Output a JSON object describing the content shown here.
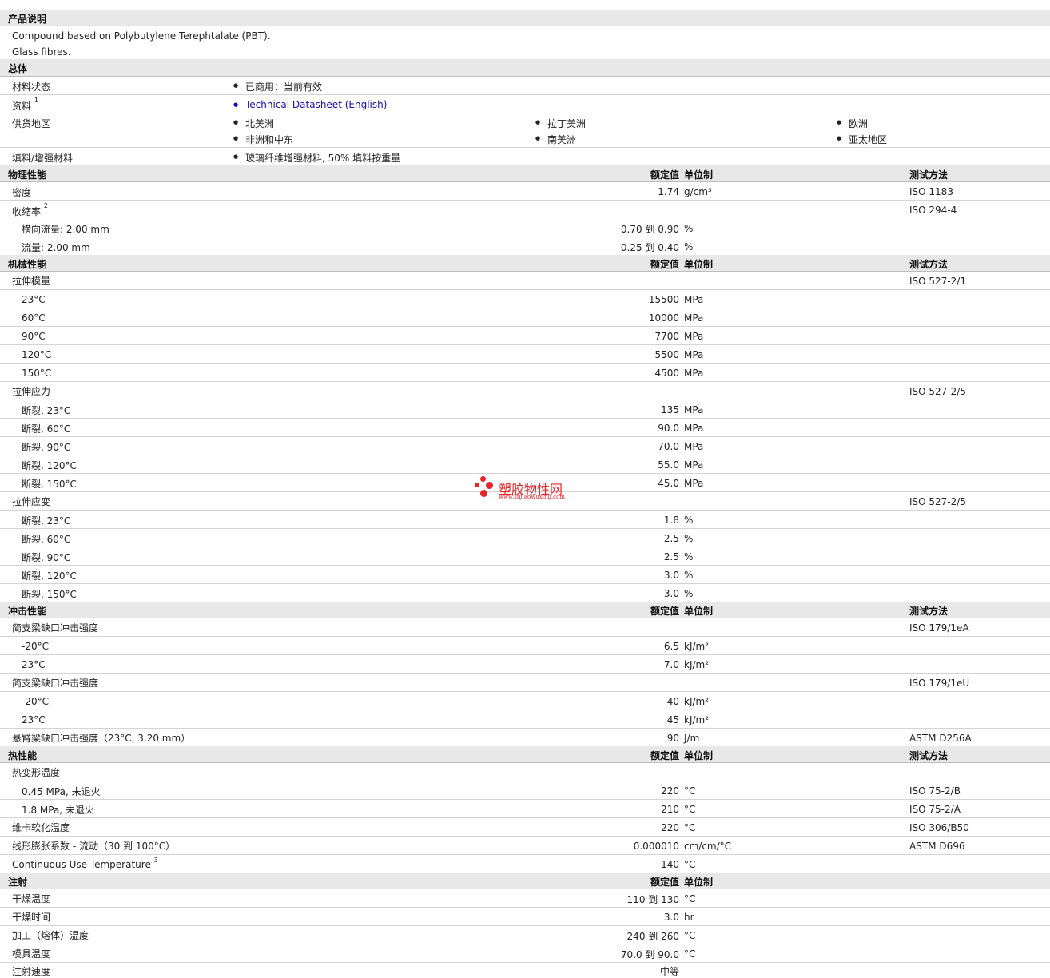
{
  "desc": {
    "header": "产品说明",
    "line1": "Compound based on Polybutylene Terephtalate (PBT).",
    "line2": "Glass fibres."
  },
  "general": {
    "header": "总体",
    "status_label": "材料状态",
    "status_value": "已商用：当前有效",
    "doc_label": "资料",
    "doc_sup": "1",
    "doc_link": "Technical Datasheet (English)",
    "region_label": "供货地区",
    "regions": [
      "北美洲",
      "拉丁美洲",
      "欧洲",
      "非洲和中东",
      "南美洲",
      "亚太地区"
    ],
    "filler_label": "填料/增强材料",
    "filler_value": "玻璃纤维增强材料, 50% 填料按重量"
  },
  "col_headers": {
    "value": "额定值",
    "unit": "单位制",
    "method": "测试方法"
  },
  "physical": {
    "header": "物理性能",
    "density_label": "密度",
    "density_value": "1.74",
    "density_unit": "g/cm³",
    "density_method": "ISO 1183",
    "shrink_label": "收缩率",
    "shrink_sup": "2",
    "shrink_method": "ISO 294-4",
    "shrink_rows": [
      {
        "label": "横向流量: 2.00 mm",
        "value": "0.70 到  0.90",
        "unit": "%"
      },
      {
        "label": "流量: 2.00 mm",
        "value": "0.25 到  0.40",
        "unit": "%"
      }
    ]
  },
  "mechanical": {
    "header": "机械性能",
    "modulus_label": "拉伸模量",
    "modulus_method": "ISO 527-2/1",
    "modulus_rows": [
      {
        "label": "23°C",
        "value": "15500",
        "unit": "MPa"
      },
      {
        "label": "60°C",
        "value": "10000",
        "unit": "MPa"
      },
      {
        "label": "90°C",
        "value": "7700",
        "unit": "MPa"
      },
      {
        "label": "120°C",
        "value": "5500",
        "unit": "MPa"
      },
      {
        "label": "150°C",
        "value": "4500",
        "unit": "MPa"
      }
    ],
    "stress_label": "拉伸应力",
    "stress_method": "ISO 527-2/5",
    "stress_rows": [
      {
        "label": "断裂, 23°C",
        "value": "135",
        "unit": "MPa"
      },
      {
        "label": "断裂, 60°C",
        "value": "90.0",
        "unit": "MPa"
      },
      {
        "label": "断裂, 90°C",
        "value": "70.0",
        "unit": "MPa"
      },
      {
        "label": "断裂, 120°C",
        "value": "55.0",
        "unit": "MPa"
      },
      {
        "label": "断裂, 150°C",
        "value": "45.0",
        "unit": "MPa"
      }
    ],
    "strain_label": "拉伸应变",
    "strain_method": "ISO 527-2/5",
    "strain_rows": [
      {
        "label": "断裂, 23°C",
        "value": "1.8",
        "unit": "%"
      },
      {
        "label": "断裂, 60°C",
        "value": "2.5",
        "unit": "%"
      },
      {
        "label": "断裂, 90°C",
        "value": "2.5",
        "unit": "%"
      },
      {
        "label": "断裂, 120°C",
        "value": "3.0",
        "unit": "%"
      },
      {
        "label": "断裂, 150°C",
        "value": "3.0",
        "unit": "%"
      }
    ]
  },
  "impact": {
    "header": "冲击性能",
    "notched_label": "简支梁缺口冲击强度",
    "notched_method": "ISO 179/1eA",
    "notched_rows": [
      {
        "label": "-20°C",
        "value": "6.5",
        "unit": "kJ/m²"
      },
      {
        "label": "23°C",
        "value": "7.0",
        "unit": "kJ/m²"
      }
    ],
    "unnotched_label": "简支梁缺口冲击强度",
    "unnotched_method": "ISO 179/1eU",
    "unnotched_rows": [
      {
        "label": "-20°C",
        "value": "40",
        "unit": "kJ/m²"
      },
      {
        "label": "23°C",
        "value": "45",
        "unit": "kJ/m²"
      }
    ],
    "izod_label": "悬臂梁缺口冲击强度（23°C, 3.20 mm）",
    "izod_value": "90",
    "izod_unit": "J/m",
    "izod_method": "ASTM D256A"
  },
  "thermal": {
    "header": "热性能",
    "hdt_label": "热变形温度",
    "hdt_rows": [
      {
        "label": "0.45 MPa, 未退火",
        "value": "220",
        "unit": "°C",
        "method": "ISO 75-2/B"
      },
      {
        "label": "1.8 MPa, 未退火",
        "value": "210",
        "unit": "°C",
        "method": "ISO 75-2/A"
      }
    ],
    "vicat_label": "维卡软化温度",
    "vicat_value": "220",
    "vicat_unit": "°C",
    "vicat_method": "ISO 306/B50",
    "clte_label": "线形膨胀系数 - 流动（30 到  100°C）",
    "clte_value": "0.000010",
    "clte_unit": "cm/cm/°C",
    "clte_method": "ASTM D696",
    "cut_label": "Continuous Use Temperature",
    "cut_sup": "3",
    "cut_value": "140",
    "cut_unit": "°C"
  },
  "injection": {
    "header": "注射",
    "rows": [
      {
        "label": "干燥温度",
        "value": "110 到  130",
        "unit": "°C"
      },
      {
        "label": "干燥时间",
        "value": "3.0",
        "unit": "hr"
      },
      {
        "label": "加工（熔体）温度",
        "value": "240 到  260",
        "unit": "°C"
      },
      {
        "label": "模具温度",
        "value": "70.0 到  90.0",
        "unit": "°C"
      },
      {
        "label": "注射速度",
        "value": "中等",
        "unit": ""
      }
    ]
  },
  "watermark": {
    "cn": "塑胶物性网",
    "url": "www.sujiaowuxing.com",
    "color": "#e8232a"
  }
}
